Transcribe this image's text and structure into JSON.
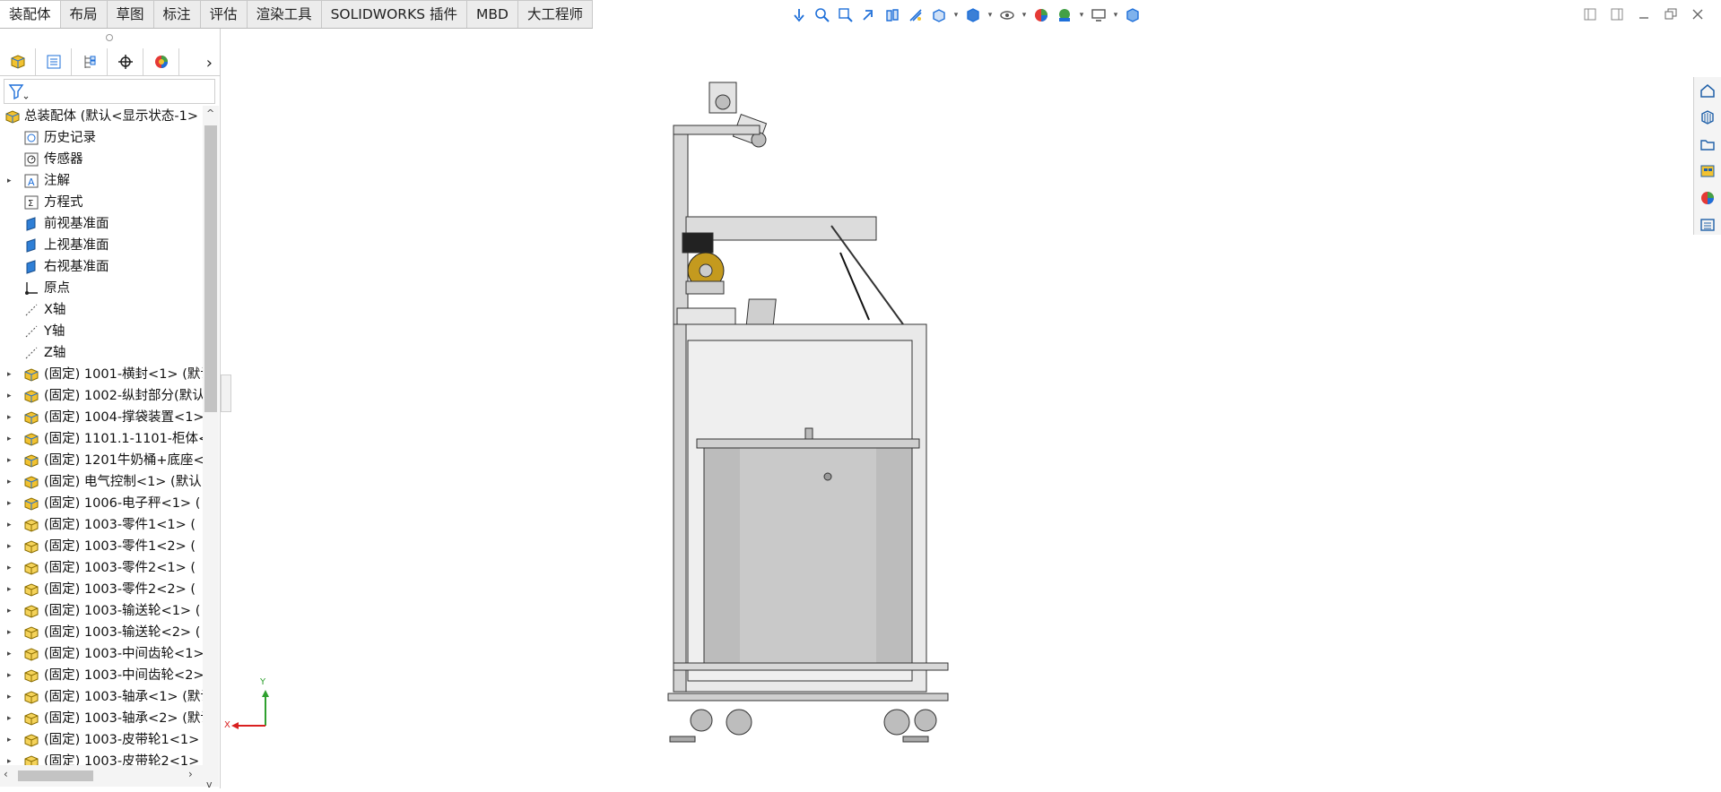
{
  "tabs": [
    "装配体",
    "布局",
    "草图",
    "标注",
    "评估",
    "渲染工具",
    "SOLIDWORKS 插件",
    "MBD",
    "大工程师"
  ],
  "view_tools": [
    "view-orientation-icon",
    "zoom-to-fit-icon",
    "zoom-to-area-icon",
    "previous-view-icon",
    "section-view-icon",
    "dynamic-annotation-icon",
    "view-settings-icon",
    "display-style-icon",
    "hide-show-items-icon",
    "edit-appearance-icon",
    "apply-scene-icon",
    "display-monitor-icon",
    "3d-view-icon"
  ],
  "panel_tabs": [
    "featuremanager-icon",
    "propertymanager-icon",
    "configurationmanager-icon",
    "dimxpert-icon",
    "display-manager-icon"
  ],
  "tree": {
    "root": "总装配体 (默认<显示状态-1>",
    "items": [
      {
        "label": "历史记录",
        "icon": "history-icon",
        "expandable": false
      },
      {
        "label": "传感器",
        "icon": "sensor-icon",
        "expandable": false
      },
      {
        "label": "注解",
        "icon": "annotation-icon",
        "expandable": true
      },
      {
        "label": "方程式",
        "icon": "equation-icon",
        "expandable": false
      },
      {
        "label": "前视基准面",
        "icon": "plane-icon",
        "expandable": false
      },
      {
        "label": "上视基准面",
        "icon": "plane-icon",
        "expandable": false
      },
      {
        "label": "右视基准面",
        "icon": "plane-icon",
        "expandable": false
      },
      {
        "label": "原点",
        "icon": "origin-icon",
        "expandable": false
      },
      {
        "label": "X轴",
        "icon": "axis-icon",
        "expandable": false
      },
      {
        "label": "Y轴",
        "icon": "axis-icon",
        "expandable": false
      },
      {
        "label": "Z轴",
        "icon": "axis-icon",
        "expandable": false
      },
      {
        "label": "(固定) 1001-横封<1> (默认",
        "icon": "assembly-icon",
        "expandable": true
      },
      {
        "label": "(固定) 1002-纵封部分(默认",
        "icon": "assembly-icon",
        "expandable": true
      },
      {
        "label": "(固定) 1004-撑袋装置<1>",
        "icon": "assembly-icon",
        "expandable": true
      },
      {
        "label": "(固定) 1101.1-1101-柜体<",
        "icon": "assembly-icon",
        "expandable": true
      },
      {
        "label": "(固定) 1201牛奶桶+底座<",
        "icon": "assembly-icon",
        "expandable": true
      },
      {
        "label": "(固定) 电气控制<1> (默认",
        "icon": "assembly-icon",
        "expandable": true
      },
      {
        "label": "(固定) 1006-电子秤<1> (",
        "icon": "assembly-icon",
        "expandable": true
      },
      {
        "label": "(固定) 1003-零件1<1> (",
        "icon": "part-icon",
        "expandable": true
      },
      {
        "label": "(固定) 1003-零件1<2> (",
        "icon": "part-icon",
        "expandable": true
      },
      {
        "label": "(固定) 1003-零件2<1> (",
        "icon": "part-icon",
        "expandable": true
      },
      {
        "label": "(固定) 1003-零件2<2> (",
        "icon": "part-icon",
        "expandable": true
      },
      {
        "label": "(固定) 1003-输送轮<1> (",
        "icon": "part-icon",
        "expandable": true
      },
      {
        "label": "(固定) 1003-输送轮<2> (",
        "icon": "part-icon",
        "expandable": true
      },
      {
        "label": "(固定) 1003-中间齿轮<1>",
        "icon": "part-icon",
        "expandable": true
      },
      {
        "label": "(固定) 1003-中间齿轮<2>",
        "icon": "part-icon",
        "expandable": true
      },
      {
        "label": "(固定) 1003-轴承<1> (默认",
        "icon": "part-icon",
        "expandable": true
      },
      {
        "label": "(固定) 1003-轴承<2> (默认",
        "icon": "part-icon",
        "expandable": true
      },
      {
        "label": "(固定) 1003-皮带轮1<1>",
        "icon": "part-icon",
        "expandable": true
      },
      {
        "label": "(固定) 1003-皮带轮2<1>",
        "icon": "part-icon",
        "expandable": true
      }
    ]
  },
  "right_tools": [
    "home-icon",
    "3d-content-icon",
    "file-explorer-icon",
    "view-palette-icon",
    "appearances-icon",
    "custom-properties-icon"
  ],
  "axes": {
    "x": "X",
    "y": "Y"
  },
  "colors": {
    "accent": "#1e6fd9",
    "assembly": "#f2c230",
    "axis_x": "#d92020",
    "axis_y": "#2fa02f"
  }
}
